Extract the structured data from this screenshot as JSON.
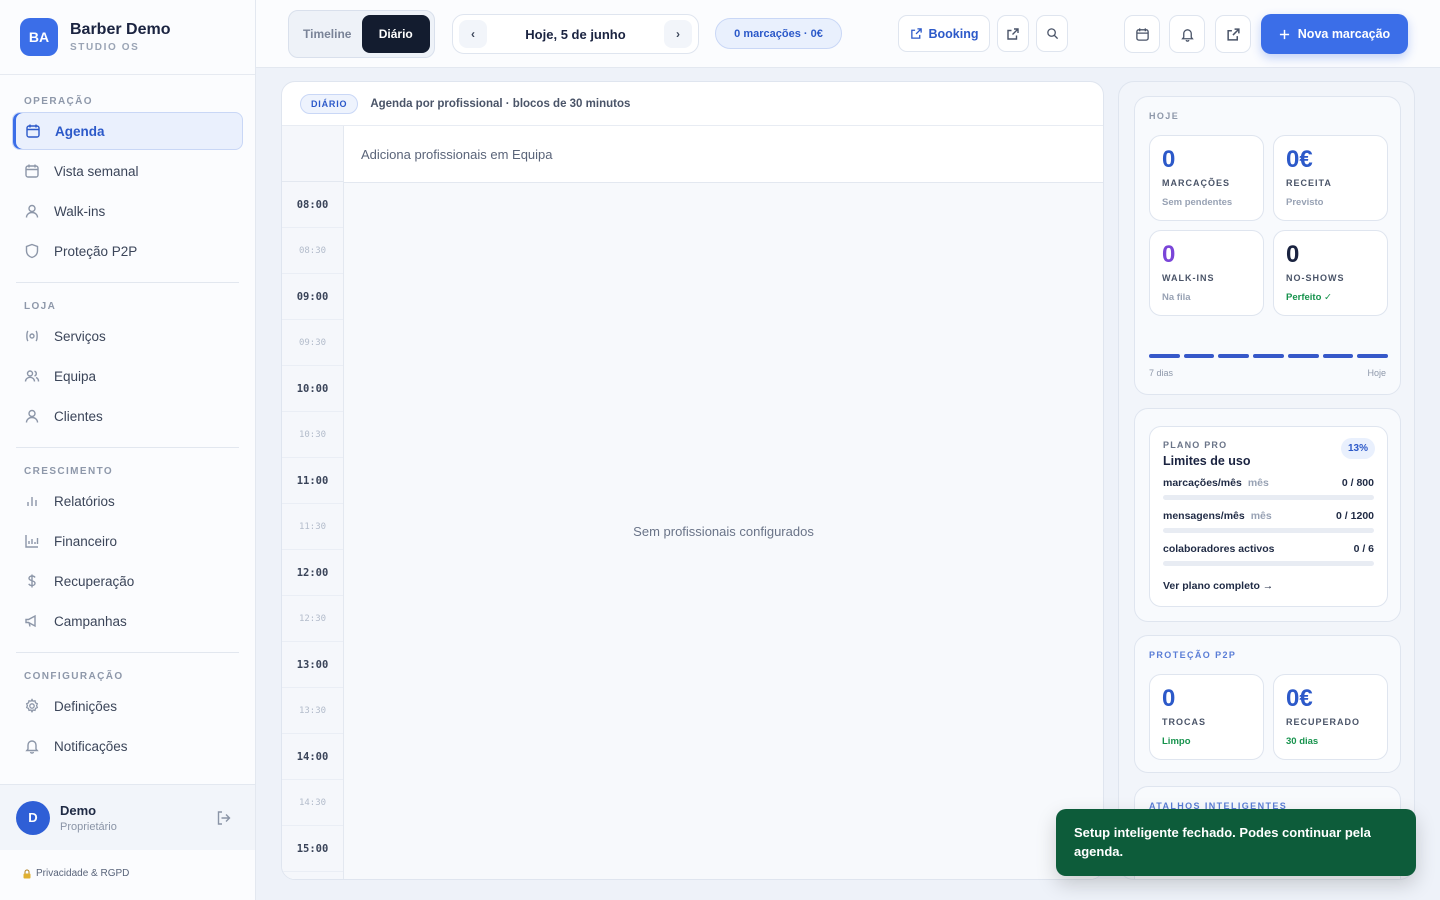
{
  "brand": {
    "initials": "BA",
    "name": "Barber Demo",
    "subtitle": "STUDIO OS"
  },
  "nav": {
    "sections": [
      {
        "title": "OPERAÇÃO",
        "items": [
          {
            "label": "Agenda",
            "icon": "calendar-icon",
            "active": true
          },
          {
            "label": "Vista semanal",
            "icon": "calendar-icon"
          },
          {
            "label": "Walk-ins",
            "icon": "user-icon"
          },
          {
            "label": "Proteção P2P",
            "icon": "shield-icon"
          }
        ]
      },
      {
        "title": "LOJA",
        "items": [
          {
            "label": "Serviços",
            "icon": "services-icon"
          },
          {
            "label": "Equipa",
            "icon": "team-icon"
          },
          {
            "label": "Clientes",
            "icon": "user-icon"
          }
        ]
      },
      {
        "title": "CRESCIMENTO",
        "items": [
          {
            "label": "Relatórios",
            "icon": "bar-chart-icon"
          },
          {
            "label": "Financeiro",
            "icon": "finance-chart-icon"
          },
          {
            "label": "Recuperação",
            "icon": "dollar-icon"
          },
          {
            "label": "Campanhas",
            "icon": "megaphone-icon"
          }
        ]
      },
      {
        "title": "CONFIGURAÇÃO",
        "items": [
          {
            "label": "Definições",
            "icon": "gear-icon"
          },
          {
            "label": "Notificações",
            "icon": "bell-icon"
          }
        ]
      }
    ]
  },
  "user": {
    "initial": "D",
    "name": "Demo",
    "role": "Proprietário"
  },
  "privacy": {
    "label": "Privacidade & RGPD",
    "icon": "lock-icon"
  },
  "topbar": {
    "view_tabs": [
      "Timeline",
      "Diário"
    ],
    "active_tab": "Diário",
    "prev": "‹",
    "next": "›",
    "date": "Hoje, 5 de junho",
    "count_pill": "0 marcações · 0€",
    "booking_label": "Booking",
    "new_booking_label": "Nova marcação"
  },
  "agenda": {
    "tag": "DIÁRIO",
    "subtitle": "Agenda por profissional · blocos de 30 minutos",
    "pro_header": "Adiciona profissionais em Equipa",
    "empty_message": "Sem profissionais configurados",
    "time_slots": [
      "08:00",
      "08:30",
      "09:00",
      "09:30",
      "10:00",
      "10:30",
      "11:00",
      "11:30",
      "12:00",
      "12:30",
      "13:00",
      "13:30",
      "14:00",
      "14:30",
      "15:00"
    ]
  },
  "today": {
    "title": "HOJE",
    "kpis": [
      {
        "value": "0",
        "label": "MARCAÇÕES",
        "sub": "Sem pendentes",
        "tone": "blue"
      },
      {
        "value": "0€",
        "label": "RECEITA",
        "sub": "Previsto",
        "tone": "blue"
      },
      {
        "value": "0",
        "label": "WALK-INS",
        "sub": "Na fila",
        "tone": "purple"
      },
      {
        "value": "0",
        "label": "NO-SHOWS",
        "sub": "Perfeito ✓",
        "tone": "dark"
      }
    ],
    "range_start": "7 dias",
    "range_end": "Hoje"
  },
  "plan": {
    "title": "PLANO PRO",
    "heading": "Limites de uso",
    "percent": "13%",
    "limits": [
      {
        "label": "marcações/mês",
        "unit": "mês",
        "value": "0 / 800",
        "fraction": 0
      },
      {
        "label": "mensagens/mês",
        "unit": "mês",
        "value": "0 / 1200",
        "fraction": 0
      },
      {
        "label": "colaboradores activos",
        "unit": "",
        "value": "0 / 6",
        "fraction": 0
      }
    ],
    "link": "Ver plano completo →"
  },
  "p2p": {
    "title": "PROTEÇÃO P2P",
    "kpis": [
      {
        "value": "0",
        "label": "TROCAS",
        "sub": "Limpo"
      },
      {
        "value": "0€",
        "label": "RECUPERADO",
        "sub": "30 dias"
      }
    ]
  },
  "shortcuts": {
    "title": "ATALHOS INTELIGENTES"
  },
  "toast": {
    "message": "Setup inteligente fechado. Podes continuar pela agenda."
  },
  "colors": {
    "accent": "#3b6ee8",
    "dark": "#131c2f",
    "success": "#0d5c3a"
  }
}
